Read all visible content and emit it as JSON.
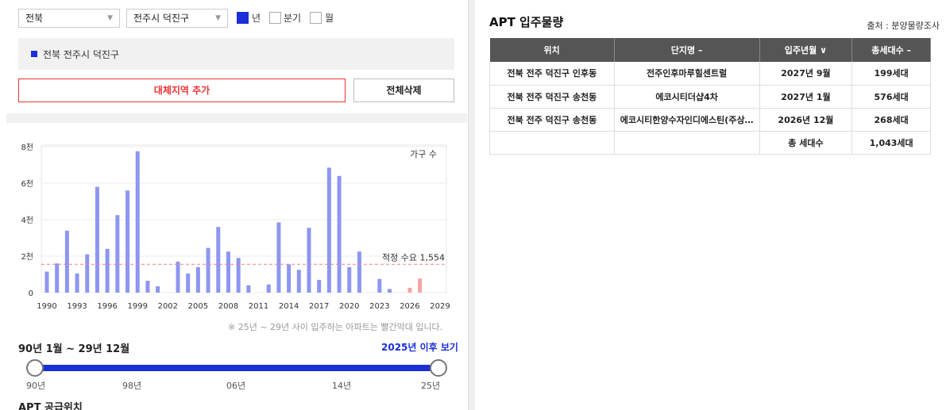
{
  "filters": {
    "region_select": "전북",
    "district_select": "전주시 덕진구",
    "period_options": [
      {
        "label": "년",
        "checked": true
      },
      {
        "label": "분기",
        "checked": false
      },
      {
        "label": "월",
        "checked": false
      }
    ]
  },
  "selected_region": "전북 전주시 덕진구",
  "buttons": {
    "add_alt_region": "대체지역 추가",
    "delete_all": "전체삭제"
  },
  "chart_data": {
    "type": "bar",
    "legend_label": "가구 수",
    "ylim": [
      0,
      8000
    ],
    "y_ticks": [
      {
        "v": 0,
        "label": "0"
      },
      {
        "v": 2000,
        "label": "2천"
      },
      {
        "v": 4000,
        "label": "4천"
      },
      {
        "v": 6000,
        "label": "6천"
      },
      {
        "v": 8000,
        "label": "8천"
      }
    ],
    "x_ticks": [
      "1990",
      "1993",
      "1996",
      "1999",
      "2002",
      "2005",
      "2008",
      "2011",
      "2014",
      "2017",
      "2020",
      "2023",
      "2026",
      "2029"
    ],
    "x_range": [
      1990,
      2029
    ],
    "years": [
      1990,
      1991,
      1992,
      1993,
      1994,
      1995,
      1996,
      1997,
      1998,
      1999,
      2000,
      2001,
      2002,
      2003,
      2004,
      2005,
      2006,
      2007,
      2008,
      2009,
      2010,
      2011,
      2012,
      2013,
      2014,
      2015,
      2016,
      2017,
      2018,
      2019,
      2020,
      2021,
      2022,
      2023,
      2024,
      2025,
      2026,
      2027,
      2028,
      2029
    ],
    "values": [
      1150,
      1600,
      3400,
      1050,
      2100,
      5800,
      2400,
      4250,
      5600,
      7750,
      650,
      350,
      0,
      1700,
      1050,
      1400,
      2450,
      3600,
      2250,
      1900,
      400,
      0,
      450,
      3850,
      1550,
      1250,
      3550,
      700,
      6850,
      6400,
      1400,
      2250,
      0,
      750,
      200,
      0,
      268,
      776,
      0,
      0
    ],
    "future_from_year": 2025,
    "colors": {
      "past": "#8d96f0",
      "future": "#f4a6a6",
      "reference": "#f08080"
    },
    "reference_line": {
      "value": 1554,
      "label": "적정 수요 1,554"
    }
  },
  "chart_note": "※ 25년 ~ 29년 사이 입주하는 아파트는 빨간막대 입니다.",
  "period_text": "90년 1월 ~ 29년 12월",
  "after_link": "2025년 이후 보기",
  "slider": {
    "ticks": [
      "90년",
      "98년",
      "06년",
      "14년",
      "25년"
    ],
    "fill_start": 0.0,
    "fill_end": 1.0
  },
  "supply_title": "APT 공급위치",
  "apt_panel": {
    "title": "APT 입주물량",
    "source": "출처 : 분양물량조사",
    "headers": [
      "위치",
      "단지명 –",
      "입주년월 ∨",
      "총세대수 –"
    ],
    "rows": [
      [
        "전북 전주 덕진구 인후동",
        "전주인후마루힐센트럴",
        "2027년 9월",
        "199세대"
      ],
      [
        "전북 전주 덕진구 송천동",
        "에코시티더샵4차",
        "2027년 1월",
        "576세대"
      ],
      [
        "전북 전주 덕진구 송천동",
        "에코시티한양수자인디에스틴(주상…",
        "2026년 12월",
        "268세대"
      ]
    ],
    "total_label": "총 세대수",
    "total_value": "1,043세대"
  }
}
